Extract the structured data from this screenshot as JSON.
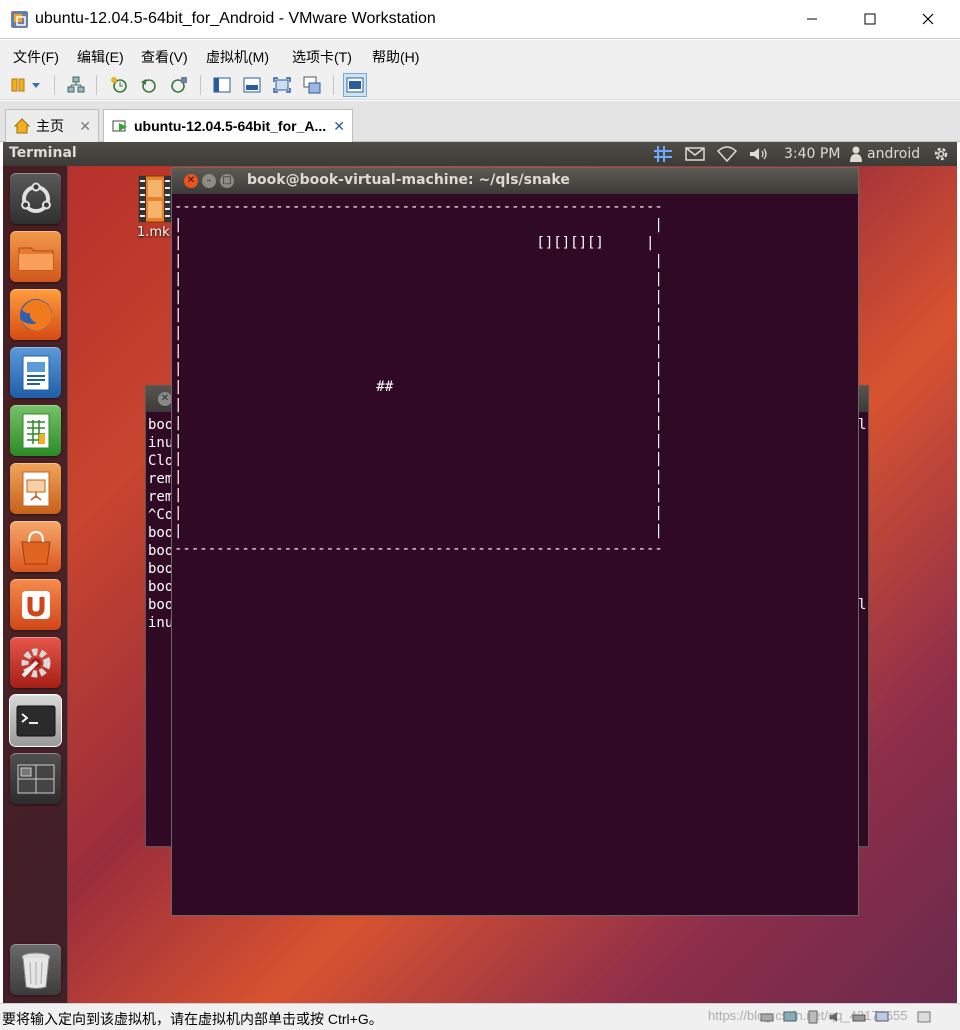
{
  "window": {
    "title": "ubuntu-12.04.5-64bit_for_Android - VMware Workstation",
    "icon": "vmware-icon",
    "controls": [
      "minimize-icon",
      "maximize-icon",
      "close-icon"
    ]
  },
  "menubar": {
    "items": [
      "文件(F)",
      "编辑(E)",
      "查看(V)",
      "虚拟机(M)",
      "选项卡(T)",
      "帮助(H)"
    ]
  },
  "toolbar": {
    "icons": [
      "pause-icon",
      "dropdown-arrow-icon",
      "send-ctrl-alt-del-icon",
      "snapshot-icon",
      "revert-snapshot-icon",
      "snapshot-manager-icon",
      "console-view-icon",
      "fit-guest-icon",
      "full-screen-icon",
      "unity-icon",
      "thumbnail-view-icon"
    ]
  },
  "tabs": [
    {
      "label": "主页",
      "icon": "home-icon",
      "close": "✕"
    },
    {
      "label": "ubuntu-12.04.5-64bit_for_A...",
      "icon": "vm-running-icon",
      "close": "✕"
    }
  ],
  "ubuntu_panel": {
    "app_title": "Terminal",
    "clock": "3:40 PM",
    "user": "android",
    "indicators": [
      "keyboard-indicator-icon",
      "mail-icon",
      "network-icon",
      "volume-icon",
      "user-icon",
      "gear-icon"
    ]
  },
  "launcher": {
    "items": [
      "ubuntu-dash-icon",
      "files-icon",
      "firefox-icon",
      "writer-icon",
      "calc-icon",
      "impress-icon",
      "software-center-icon",
      "ubuntu-one-icon",
      "system-settings-icon",
      "terminal-icon",
      "workspace-switcher-icon",
      "trash-icon"
    ]
  },
  "desktop": {
    "file_label": "1.mk"
  },
  "background_terminal": {
    "lines": [
      "boo",
      "inu",
      "Clo",
      "rem",
      "rem",
      "^Co",
      "boo",
      "boo",
      "boo",
      "boo",
      "boo",
      "inu"
    ],
    "right_chars": [
      "l",
      "",
      "",
      "",
      "",
      "",
      "",
      "",
      "",
      "",
      "l",
      ""
    ]
  },
  "terminal": {
    "title": "book@book-virtual-machine: ~/qls/snake",
    "screen_lines": [
      "----------------------------------------------------------",
      "|                                                        |",
      "|                                          [][][][]     |",
      "|                                                        |",
      "|                                                        |",
      "|                                                        |",
      "|                                                        |",
      "|                                                        |",
      "|                                                        |",
      "|                                                        |",
      "|                       ##                               |",
      "|                                                        |",
      "|                                                        |",
      "|                                                        |",
      "|                                                        |",
      "|                                                        |",
      "|                                                        |",
      "|                                                        |",
      "|                                                        |",
      "----------------------------------------------------------"
    ]
  },
  "statusbar": {
    "text": "要将输入定向到该虚拟机，请在虚拟机内部单击或按 Ctrl+G。",
    "watermark": "https://blog.csdn.net/qq_43176655",
    "icons": [
      "hdd-icon",
      "network-adapter-icon",
      "usb-icon",
      "sound-icon",
      "printer-icon",
      "display-icon",
      "message-icon"
    ]
  },
  "colors": {
    "terminal_bg": "#300a24",
    "panel_bg": "#3c3b37",
    "close_button": "#e95420"
  }
}
